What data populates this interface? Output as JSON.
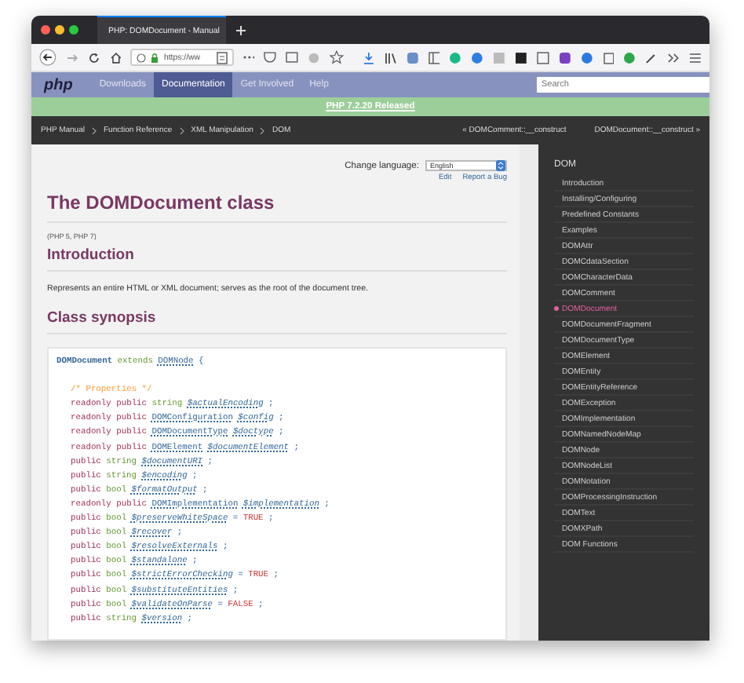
{
  "browser": {
    "tab_title": "PHP: DOMDocument - Manual",
    "url": "https://ww"
  },
  "nav": {
    "logo": "php",
    "items": [
      {
        "label": "Downloads",
        "selected": false
      },
      {
        "label": "Documentation",
        "selected": true
      },
      {
        "label": "Get Involved",
        "selected": false
      },
      {
        "label": "Help",
        "selected": false
      }
    ],
    "search": {
      "placeholder": "Search"
    }
  },
  "banner": "PHP 7.2.20 Released",
  "breadcrumb": {
    "items": [
      "PHP Manual",
      "Function Reference",
      "XML Manipulation",
      "DOM"
    ],
    "prev": "« DOMComment::__construct",
    "next": "DOMDocument::__construct »"
  },
  "content": {
    "language_label": "Change language:",
    "language": "English",
    "links": [
      "Edit",
      "Report a Bug"
    ],
    "title": "The DOMDocument class",
    "versions": "(PHP 5, PHP 7)",
    "intro_heading": "Introduction",
    "intro_text": "Represents an entire HTML or XML document; serves as the root of the document tree.",
    "synopsis_heading": "Class synopsis",
    "code": [
      {
        "indent": false,
        "tokens": [
          {
            "kind": "classname",
            "text": "DOMDocument"
          },
          {
            "kind": "keyword",
            "text": "extends"
          },
          {
            "kind": "class",
            "text": "DOMNode"
          },
          {
            "kind": "punct",
            "text": "{"
          }
        ]
      },
      {
        "indent": true,
        "tokens": [
          {
            "kind": "comment",
            "text": "/* Properties */"
          }
        ]
      },
      {
        "indent": true,
        "tokens": [
          {
            "kind": "modifier",
            "text": "readonly public"
          },
          {
            "kind": "type",
            "text": "string"
          },
          {
            "kind": "var",
            "text": "$actualEncoding"
          },
          {
            "kind": "punct",
            "text": ";"
          }
        ]
      },
      {
        "indent": true,
        "tokens": [
          {
            "kind": "modifier",
            "text": "readonly public"
          },
          {
            "kind": "class",
            "text": "DOMConfiguration"
          },
          {
            "kind": "var",
            "text": "$config"
          },
          {
            "kind": "punct",
            "text": ";"
          }
        ]
      },
      {
        "indent": true,
        "tokens": [
          {
            "kind": "modifier",
            "text": "readonly public"
          },
          {
            "kind": "class",
            "text": "DOMDocumentType"
          },
          {
            "kind": "var",
            "text": "$doctype"
          },
          {
            "kind": "punct",
            "text": ";"
          }
        ]
      },
      {
        "indent": true,
        "tokens": [
          {
            "kind": "modifier",
            "text": "readonly public"
          },
          {
            "kind": "class",
            "text": "DOMElement"
          },
          {
            "kind": "var",
            "text": "$documentElement"
          },
          {
            "kind": "punct",
            "text": ";"
          }
        ]
      },
      {
        "indent": true,
        "tokens": [
          {
            "kind": "modifier",
            "text": "public"
          },
          {
            "kind": "type",
            "text": "string"
          },
          {
            "kind": "var",
            "text": "$documentURI"
          },
          {
            "kind": "punct",
            "text": ";"
          }
        ]
      },
      {
        "indent": true,
        "tokens": [
          {
            "kind": "modifier",
            "text": "public"
          },
          {
            "kind": "type",
            "text": "string"
          },
          {
            "kind": "var",
            "text": "$encoding"
          },
          {
            "kind": "punct",
            "text": ";"
          }
        ]
      },
      {
        "indent": true,
        "tokens": [
          {
            "kind": "modifier",
            "text": "public"
          },
          {
            "kind": "type",
            "text": "bool"
          },
          {
            "kind": "var",
            "text": "$formatOutput"
          },
          {
            "kind": "punct",
            "text": ";"
          }
        ]
      },
      {
        "indent": true,
        "tokens": [
          {
            "kind": "modifier",
            "text": "readonly public"
          },
          {
            "kind": "class",
            "text": "DOMImplementation"
          },
          {
            "kind": "var",
            "text": "$implementation"
          },
          {
            "kind": "punct",
            "text": ";"
          }
        ]
      },
      {
        "indent": true,
        "tokens": [
          {
            "kind": "modifier",
            "text": "public"
          },
          {
            "kind": "type",
            "text": "bool"
          },
          {
            "kind": "var",
            "text": "$preserveWhiteSpace"
          },
          {
            "kind": "op",
            "text": "="
          },
          {
            "kind": "const",
            "text": "TRUE"
          },
          {
            "kind": "punct",
            "text": ";"
          }
        ]
      },
      {
        "indent": true,
        "tokens": [
          {
            "kind": "modifier",
            "text": "public"
          },
          {
            "kind": "type",
            "text": "bool"
          },
          {
            "kind": "var",
            "text": "$recover"
          },
          {
            "kind": "punct",
            "text": ";"
          }
        ]
      },
      {
        "indent": true,
        "tokens": [
          {
            "kind": "modifier",
            "text": "public"
          },
          {
            "kind": "type",
            "text": "bool"
          },
          {
            "kind": "var",
            "text": "$resolveExternals"
          },
          {
            "kind": "punct",
            "text": ";"
          }
        ]
      },
      {
        "indent": true,
        "tokens": [
          {
            "kind": "modifier",
            "text": "public"
          },
          {
            "kind": "type",
            "text": "bool"
          },
          {
            "kind": "var",
            "text": "$standalone"
          },
          {
            "kind": "punct",
            "text": ";"
          }
        ]
      },
      {
        "indent": true,
        "tokens": [
          {
            "kind": "modifier",
            "text": "public"
          },
          {
            "kind": "type",
            "text": "bool"
          },
          {
            "kind": "var",
            "text": "$strictErrorChecking"
          },
          {
            "kind": "op",
            "text": "="
          },
          {
            "kind": "const",
            "text": "TRUE"
          },
          {
            "kind": "punct",
            "text": ";"
          }
        ]
      },
      {
        "indent": true,
        "tokens": [
          {
            "kind": "modifier",
            "text": "public"
          },
          {
            "kind": "type",
            "text": "bool"
          },
          {
            "kind": "var",
            "text": "$substituteEntities"
          },
          {
            "kind": "punct",
            "text": ";"
          }
        ]
      },
      {
        "indent": true,
        "tokens": [
          {
            "kind": "modifier",
            "text": "public"
          },
          {
            "kind": "type",
            "text": "bool"
          },
          {
            "kind": "var",
            "text": "$validateOnParse"
          },
          {
            "kind": "op",
            "text": "="
          },
          {
            "kind": "const",
            "text": "FALSE"
          },
          {
            "kind": "punct",
            "text": ";"
          }
        ]
      },
      {
        "indent": true,
        "tokens": [
          {
            "kind": "modifier",
            "text": "public"
          },
          {
            "kind": "type",
            "text": "string"
          },
          {
            "kind": "var",
            "text": "$version"
          },
          {
            "kind": "punct",
            "text": ";"
          }
        ]
      }
    ]
  },
  "sidebar": {
    "heading": "DOM",
    "items": [
      {
        "label": "Introduction",
        "selected": false
      },
      {
        "label": "Installing/Configuring",
        "selected": false
      },
      {
        "label": "Predefined Constants",
        "selected": false
      },
      {
        "label": "Examples",
        "selected": false
      },
      {
        "label": "DOMAttr",
        "selected": false
      },
      {
        "label": "DOMCdataSection",
        "selected": false
      },
      {
        "label": "DOMCharacterData",
        "selected": false
      },
      {
        "label": "DOMComment",
        "selected": false
      },
      {
        "label": "DOMDocument",
        "selected": true
      },
      {
        "label": "DOMDocumentFragment",
        "selected": false
      },
      {
        "label": "DOMDocumentType",
        "selected": false
      },
      {
        "label": "DOMElement",
        "selected": false
      },
      {
        "label": "DOMEntity",
        "selected": false
      },
      {
        "label": "DOMEntityReference",
        "selected": false
      },
      {
        "label": "DOMException",
        "selected": false
      },
      {
        "label": "DOMImplementation",
        "selected": false
      },
      {
        "label": "DOMNamedNodeMap",
        "selected": false
      },
      {
        "label": "DOMNode",
        "selected": false
      },
      {
        "label": "DOMNodeList",
        "selected": false
      },
      {
        "label": "DOMNotation",
        "selected": false
      },
      {
        "label": "DOMProcessingInstruction",
        "selected": false
      },
      {
        "label": "DOMText",
        "selected": false
      },
      {
        "label": "DOMXPath",
        "selected": false
      },
      {
        "label": "DOM Functions",
        "selected": false
      }
    ]
  }
}
